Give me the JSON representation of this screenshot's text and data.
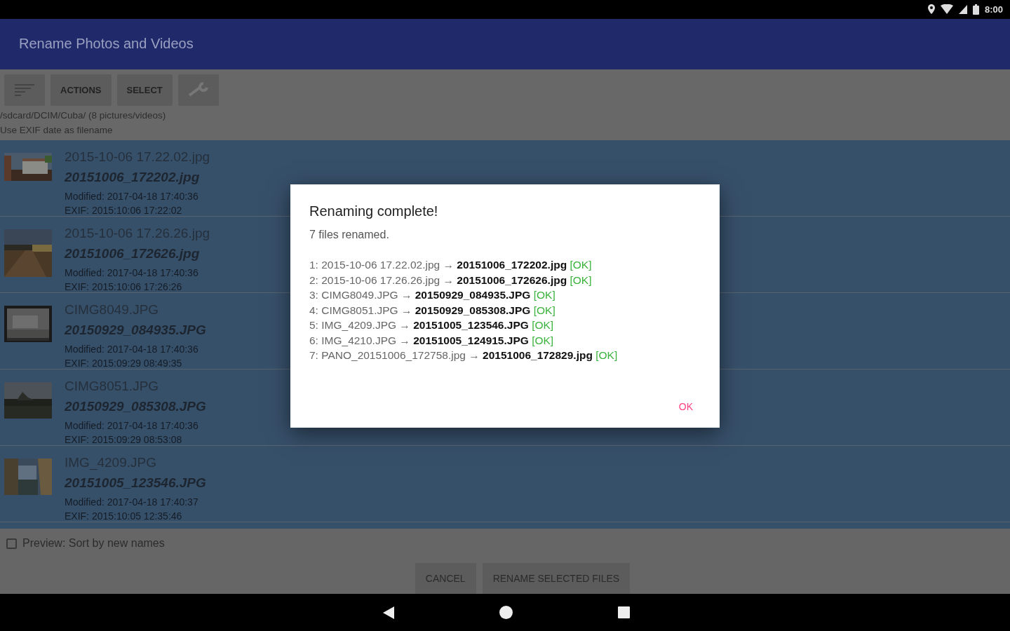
{
  "status_bar": {
    "time": "8:00"
  },
  "app_bar": {
    "title": "Rename Photos and Videos"
  },
  "toolbar": {
    "buttons": [
      {
        "kind": "sort-icon"
      },
      {
        "kind": "text",
        "label": "ACTIONS"
      },
      {
        "kind": "text",
        "label": "SELECT"
      },
      {
        "kind": "wrench-icon"
      }
    ]
  },
  "folder": {
    "path": "/sdcard/DCIM/Cuba/ (8 pictures/videos)",
    "mode": "Use EXIF date as filename"
  },
  "files": [
    {
      "original": "2015-10-06 17.22.02.jpg",
      "new_name": "20151006_172202.jpg",
      "modified": "Modified: 2017-04-18 17:40:36",
      "exif": "EXIF: 2015:10:06 17:22:02",
      "selected": true
    },
    {
      "original": "2015-10-06 17.26.26.jpg",
      "new_name": "20151006_172626.jpg",
      "modified": "Modified: 2017-04-18 17:40:36",
      "exif": "EXIF: 2015:10:06 17:26:26",
      "selected": true
    },
    {
      "original": "CIMG8049.JPG",
      "new_name": "20150929_084935.JPG",
      "modified": "Modified: 2017-04-18 17:40:36",
      "exif": "EXIF: 2015:09:29 08:49:35",
      "selected": true
    },
    {
      "original": "CIMG8051.JPG",
      "new_name": "20150929_085308.JPG",
      "modified": "Modified: 2017-04-18 17:40:36",
      "exif": "EXIF: 2015:09:29 08:53:08",
      "selected": true
    },
    {
      "original": "IMG_4209.JPG",
      "new_name": "20151005_123546.JPG",
      "modified": "Modified: 2017-04-18 17:40:37",
      "exif": "EXIF: 2015:10:05 12:35:46",
      "selected": true
    }
  ],
  "preview_sort": {
    "label": "Preview: Sort by new names",
    "checked": false
  },
  "bottom_buttons": [
    "CANCEL",
    "RENAME SELECTED FILES"
  ],
  "dialog": {
    "title": "Renaming complete!",
    "summary": "7 files renamed.",
    "results": [
      {
        "index": "1:",
        "old": "2015-10-06 17.22.02.jpg",
        "arrow": "→",
        "new": "20151006_172202.jpg",
        "status": "[OK]"
      },
      {
        "index": "2:",
        "old": "2015-10-06 17.26.26.jpg",
        "arrow": "→",
        "new": "20151006_172626.jpg",
        "status": "[OK]"
      },
      {
        "index": "3:",
        "old": "CIMG8049.JPG",
        "arrow": "→",
        "new": "20150929_084935.JPG",
        "status": "[OK]"
      },
      {
        "index": "4:",
        "old": "CIMG8051.JPG",
        "arrow": "→",
        "new": "20150929_085308.JPG",
        "status": "[OK]"
      },
      {
        "index": "5:",
        "old": "IMG_4209.JPG",
        "arrow": "→",
        "new": "20151005_123546.JPG",
        "status": "[OK]"
      },
      {
        "index": "6:",
        "old": "IMG_4210.JPG",
        "arrow": "→",
        "new": "20151005_124915.JPG",
        "status": "[OK]"
      },
      {
        "index": "7:",
        "old": "PANO_20151006_172758.jpg",
        "arrow": "→",
        "new": "20151006_172829.jpg",
        "status": "[OK]"
      }
    ],
    "button": "OK"
  }
}
